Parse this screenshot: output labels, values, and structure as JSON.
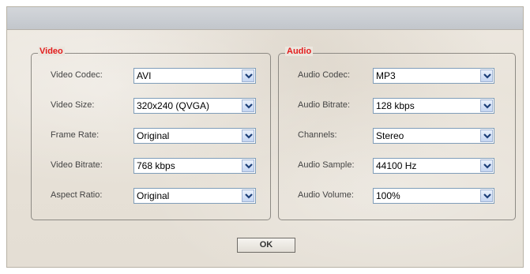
{
  "video": {
    "title": "Video",
    "fields": [
      {
        "label": "Video Codec:",
        "value": "AVI"
      },
      {
        "label": "Video Size:",
        "value": "320x240 (QVGA)"
      },
      {
        "label": "Frame Rate:",
        "value": "Original"
      },
      {
        "label": "Video Bitrate:",
        "value": "768 kbps"
      },
      {
        "label": "Aspect Ratio:",
        "value": "Original"
      }
    ]
  },
  "audio": {
    "title": "Audio",
    "fields": [
      {
        "label": "Audio Codec:",
        "value": "MP3"
      },
      {
        "label": "Audio Bitrate:",
        "value": "128 kbps"
      },
      {
        "label": "Channels:",
        "value": "Stereo"
      },
      {
        "label": "Audio Sample:",
        "value": "44100 Hz"
      },
      {
        "label": "Audio Volume:",
        "value": "100%"
      }
    ]
  },
  "ok_label": "OK",
  "icons": {
    "dropdown": "chevron-down-icon"
  },
  "colors": {
    "legend": "#e31c1c",
    "select_border": "#7f9db9"
  }
}
